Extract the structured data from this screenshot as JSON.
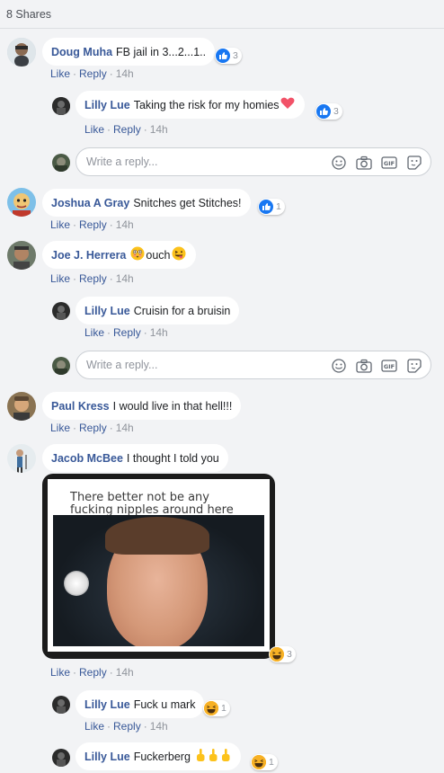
{
  "shares": "8 Shares",
  "reply_placeholder": "Write a reply...",
  "comments": [
    {
      "author": "Doug Muha",
      "text": "FB jail in 3...2...1..",
      "like": "Like",
      "reply": "Reply",
      "time": "14h",
      "reaction_count": "3"
    },
    {
      "author": "Lilly Lue",
      "text": "Taking the risk for my homies",
      "like": "Like",
      "reply": "Reply",
      "time": "14h",
      "reaction_count": "3"
    },
    {
      "author": "Joshua A Gray",
      "text": "Snitches get Stitches!",
      "like": "Like",
      "reply": "Reply",
      "time": "14h",
      "reaction_count": "1"
    },
    {
      "author": "Joe J. Herrera",
      "text": "ouch",
      "like": "Like",
      "reply": "Reply",
      "time": "14h"
    },
    {
      "author": "Lilly Lue",
      "text": "Cruisin for a bruisin",
      "like": "Like",
      "reply": "Reply",
      "time": "14h"
    },
    {
      "author": "Paul Kress",
      "text": "I would live in that hell!!!",
      "like": "Like",
      "reply": "Reply",
      "time": "14h"
    },
    {
      "author": "Jacob McBee",
      "text": "I thought I told you",
      "like": "Like",
      "reply": "Reply",
      "time": "14h",
      "reaction_count": "3",
      "image_caption": "There better not be any fucking nipples around here"
    },
    {
      "author": "Lilly Lue",
      "text": "Fuck u mark",
      "like": "Like",
      "reply": "Reply",
      "time": "14h",
      "reaction_count": "1"
    },
    {
      "author": "Lilly Lue",
      "text": "Fuckerberg",
      "reaction_count": "1"
    }
  ],
  "colors": {
    "link": "#385898",
    "like_blue": "#1877f2",
    "background": "#f2f3f5"
  },
  "icons": [
    "like-icon",
    "heart-icon",
    "haha-icon",
    "smiley-icon",
    "camera-icon",
    "gif-icon",
    "sticker-icon",
    "middle-finger-emoji",
    "flushed-emoji",
    "tongue-emoji"
  ]
}
